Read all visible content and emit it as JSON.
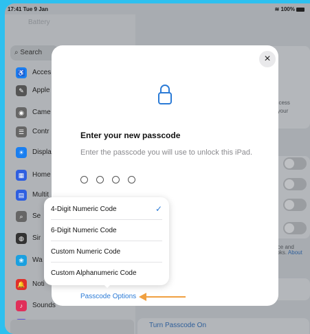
{
  "status_bar": {
    "time": "17:41 Tue 9 Jan",
    "wifi_battery": "100%"
  },
  "sidebar": {
    "faded_item": "Battery",
    "search_placeholder": "Search",
    "items": [
      {
        "label": "Acces",
        "icon": "accessibility-icon",
        "color": "#1a7ff0",
        "glyph": "♿"
      },
      {
        "label": "Apple",
        "icon": "pencil-icon",
        "color": "#555",
        "glyph": "✎"
      },
      {
        "label": "Came",
        "icon": "camera-icon",
        "color": "#666",
        "glyph": "◉"
      },
      {
        "label": "Contr",
        "icon": "control-centre-icon",
        "color": "#666",
        "glyph": "☰"
      },
      {
        "label": "Displa",
        "icon": "display-icon",
        "color": "#1a7ff0",
        "glyph": "☀"
      },
      {
        "label": "Home",
        "icon": "home-screen-icon",
        "color": "#2f5fe0",
        "glyph": "▦"
      },
      {
        "label": "Multit",
        "icon": "multitasking-icon",
        "color": "#2f5fe0",
        "glyph": "▤"
      },
      {
        "label": "Se",
        "icon": "search-settings-icon",
        "color": "#666",
        "glyph": "⌕"
      },
      {
        "label": "Sir",
        "icon": "siri-icon",
        "color": "#333",
        "glyph": "◍"
      },
      {
        "label": "Wa",
        "icon": "wallpaper-icon",
        "color": "#1aa0e0",
        "glyph": "❀"
      },
      {
        "label": "Noti",
        "icon": "notifications-icon",
        "color": "#e0302a",
        "glyph": "🔔"
      },
      {
        "label": "Sounds",
        "icon": "sounds-icon",
        "color": "#e0305a",
        "glyph": "♪"
      },
      {
        "label": "Focus",
        "icon": "focus-icon",
        "color": "#5b4fd8",
        "glyph": "☾"
      }
    ]
  },
  "background": {
    "access_text_1": "access",
    "access_text_2": "e your",
    "footnote_1": "vice and",
    "footnote_2": "ooks.",
    "footnote_link": "About",
    "turn_passcode_on": "Turn Passcode On"
  },
  "modal": {
    "title": "Enter your new passcode",
    "subtitle": "Enter the passcode you will use to unlock this iPad.",
    "passcode_length_shown": 4,
    "options_link": "Passcode Options"
  },
  "popover": {
    "options": [
      {
        "label": "4-Digit Numeric Code",
        "selected": true
      },
      {
        "label": "6-Digit Numeric Code",
        "selected": false
      },
      {
        "label": "Custom Numeric Code",
        "selected": false
      },
      {
        "label": "Custom Alphanumeric Code",
        "selected": false
      }
    ],
    "check_glyph": "✓"
  },
  "colors": {
    "accent": "#2a7ad6",
    "annotation_arrow": "#f0a040",
    "frame": "#2ec0ef"
  }
}
